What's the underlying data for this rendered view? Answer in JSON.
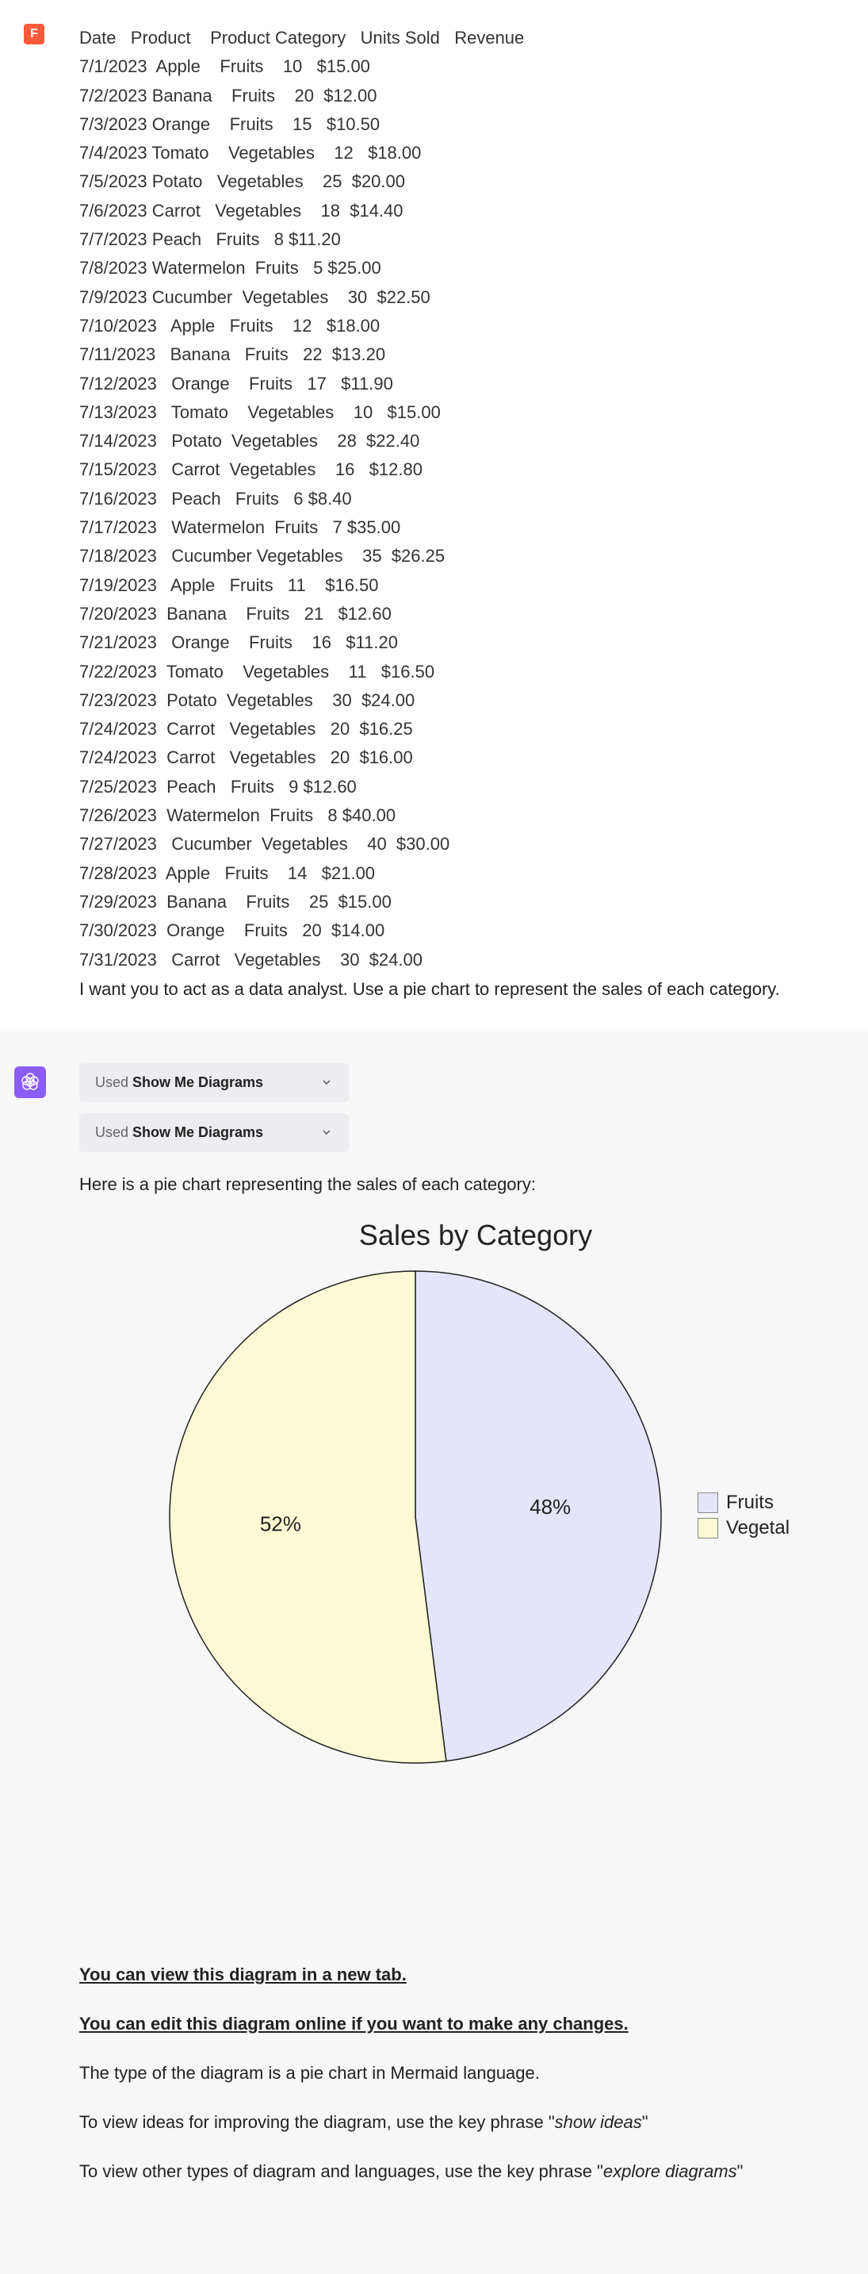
{
  "logo_letter": "F",
  "table": {
    "header": "Date   Product    Product Category   Units Sold   Revenue",
    "rows": [
      "7/1/2023  Apple    Fruits    10   $15.00",
      "7/2/2023 Banana    Fruits    20  $12.00",
      "7/3/2023 Orange    Fruits    15   $10.50",
      "7/4/2023 Tomato    Vegetables    12   $18.00",
      "7/5/2023 Potato   Vegetables    25  $20.00",
      "7/6/2023 Carrot   Vegetables    18  $14.40",
      "7/7/2023 Peach   Fruits   8 $11.20",
      "7/8/2023 Watermelon  Fruits   5 $25.00",
      "7/9/2023 Cucumber  Vegetables    30  $22.50",
      "7/10/2023   Apple   Fruits    12   $18.00",
      "7/11/2023   Banana   Fruits   22  $13.20",
      "7/12/2023   Orange    Fruits   17   $11.90",
      "7/13/2023   Tomato    Vegetables    10   $15.00",
      "7/14/2023   Potato  Vegetables    28  $22.40",
      "7/15/2023   Carrot  Vegetables    16   $12.80",
      "7/16/2023   Peach   Fruits   6 $8.40",
      "7/17/2023   Watermelon  Fruits   7 $35.00",
      "7/18/2023   Cucumber Vegetables    35  $26.25",
      "7/19/2023   Apple   Fruits   11    $16.50",
      "7/20/2023  Banana    Fruits   21   $12.60",
      "7/21/2023   Orange    Fruits    16   $11.20",
      "7/22/2023  Tomato    Vegetables    11   $16.50",
      "7/23/2023  Potato  Vegetables    30  $24.00",
      "7/24/2023  Carrot   Vegetables   20  $16.25",
      "7/24/2023  Carrot   Vegetables   20  $16.00",
      "7/25/2023  Peach   Fruits   9 $12.60",
      "7/26/2023  Watermelon  Fruits   8 $40.00",
      "7/27/2023   Cucumber  Vegetables    40  $30.00",
      "7/28/2023  Apple   Fruits    14   $21.00",
      "7/29/2023  Banana    Fruits    25  $15.00",
      "7/30/2023  Orange    Fruits   20  $14.00",
      "7/31/2023   Carrot   Vegetables    30  $24.00"
    ]
  },
  "prompt": "I want you to act as a data analyst. Use a pie chart to represent the sales of each category.",
  "used": {
    "prefix": "Used ",
    "name": "Show Me Diagrams"
  },
  "intro": "Here is a pie chart representing the sales of each category:",
  "chart_data": {
    "type": "pie",
    "title": "Sales by Category",
    "series": [
      {
        "name": "Fruits",
        "value": 48,
        "label": "48%",
        "color": "#e4e4fb"
      },
      {
        "name": "Vegetables",
        "value": 52,
        "label": "52%",
        "color": "#fbfad4",
        "legend": "Vegetal"
      }
    ]
  },
  "links": {
    "view": "You can view this diagram in a new tab.",
    "edit": "You can edit this diagram online if you want to make any changes.",
    "type_text": "The type of the diagram is a pie chart in Mermaid language.",
    "ideas_pre": "To view ideas for improving the diagram, use the key phrase \"",
    "ideas_em": "show ideas",
    "ideas_post": "\"",
    "explore_pre": "To view other types of diagram and languages, use the key phrase \"",
    "explore_em": "explore diagrams",
    "explore_post": "\""
  }
}
